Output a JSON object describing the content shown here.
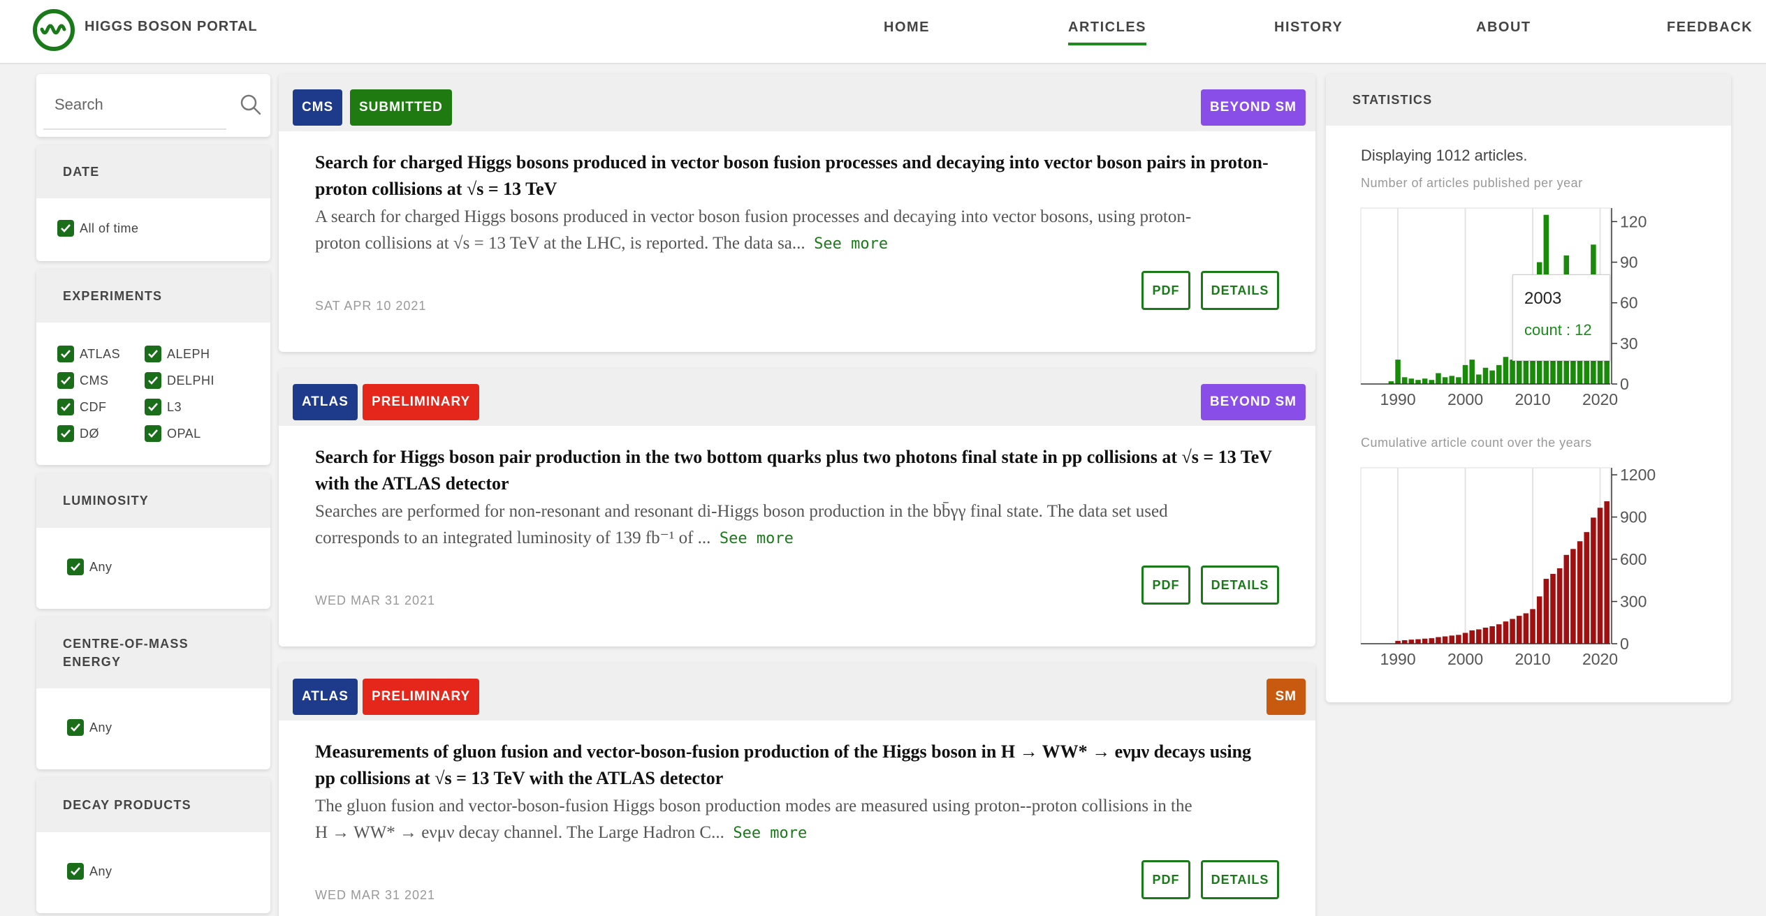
{
  "brand": "HIGGS BOSON PORTAL",
  "nav": [
    "HOME",
    "ARTICLES",
    "HISTORY",
    "ABOUT",
    "FEEDBACK"
  ],
  "search_placeholder": "Search",
  "filters": {
    "date": {
      "title": "DATE",
      "option": "All of time"
    },
    "experiments": {
      "title": "EXPERIMENTS",
      "left": [
        "ATLAS",
        "CMS",
        "CDF",
        "DØ"
      ],
      "right": [
        "ALEPH",
        "DELPHI",
        "L3",
        "OPAL"
      ]
    },
    "luminosity": {
      "title": "LUMINOSITY",
      "option": "Any"
    },
    "energy": {
      "title_line1": "CENTRE-OF-MASS",
      "title_line2": "ENERGY",
      "option": "Any"
    },
    "decay": {
      "title": "DECAY PRODUCTS",
      "option": "Any"
    }
  },
  "articles": [
    {
      "experiment": "CMS",
      "status": "SUBMITTED",
      "category": "BEYOND SM",
      "title_line1": "Search for charged Higgs bosons produced in vector boson fusion processes and decaying into vector boson pairs in proton-",
      "title_line2": "proton collisions at √s = 13 TeV",
      "abstract_line1": "A search for charged Higgs bosons produced in vector boson fusion processes and decaying into vector bosons, using proton-",
      "abstract_line2": "proton collisions at √s = 13 TeV at the LHC, is reported. The data sa...",
      "see_more": "See more",
      "date": "SAT APR 10 2021",
      "pdf": "PDF",
      "details": "DETAILS"
    },
    {
      "experiment": "ATLAS",
      "status": "PRELIMINARY",
      "category": "BEYOND SM",
      "title_line1": "Search for Higgs boson pair production in the two bottom quarks plus two photons final state in pp collisions at √s = 13 TeV",
      "title_line2": "with the ATLAS detector",
      "abstract_line1": "Searches are performed for non-resonant and resonant di-Higgs boson production in the bb̄γγ final state. The data set used",
      "abstract_line2": "corresponds to an integrated luminosity of 139 fb⁻¹ of ...",
      "see_more": "See more",
      "date": "WED MAR 31 2021",
      "pdf": "PDF",
      "details": "DETAILS"
    },
    {
      "experiment": "ATLAS",
      "status": "PRELIMINARY",
      "category": "SM",
      "title_line1": "Measurements of gluon fusion and vector-boson-fusion production of the Higgs boson in H → WW* → eνμν decays using",
      "title_line2": "pp collisions at √s = 13 TeV with the ATLAS detector",
      "abstract_line1": "The gluon fusion and vector-boson-fusion Higgs boson production modes are measured using proton--proton collisions in the",
      "abstract_line2": "H → WW* → eνμν decay channel. The Large Hadron C...",
      "see_more": "See more",
      "date": "WED MAR 31 2021",
      "pdf": "PDF",
      "details": "DETAILS"
    }
  ],
  "statistics": {
    "title": "STATISTICS",
    "display_text": "Displaying 1012 articles.",
    "chart1_label": "Number of articles published per year",
    "chart2_label": "Cumulative article count over the years",
    "tooltip_year": "2003",
    "tooltip_count": "count : 12"
  },
  "chart_data": [
    {
      "type": "bar",
      "x": [
        1985,
        1986,
        1987,
        1988,
        1989,
        1990,
        1991,
        1992,
        1993,
        1994,
        1995,
        1996,
        1997,
        1998,
        1999,
        2000,
        2001,
        2002,
        2003,
        2004,
        2005,
        2006,
        2007,
        2008,
        2009,
        2010,
        2011,
        2012,
        2013,
        2014,
        2015,
        2016,
        2017,
        2018,
        2019,
        2020,
        2021
      ],
      "values": [
        0,
        0,
        0,
        0,
        2,
        18,
        5,
        4,
        3,
        4,
        3,
        8,
        5,
        6,
        5,
        14,
        18,
        7,
        12,
        10,
        14,
        20,
        18,
        22,
        18,
        30,
        90,
        125,
        35,
        40,
        95,
        42,
        55,
        65,
        103,
        70,
        25
      ],
      "xticks": [
        1990,
        2000,
        2010,
        2020
      ],
      "yticks": [
        0,
        30,
        60,
        90,
        120
      ],
      "ylim": [
        0,
        130
      ],
      "color": "#1a8a0a"
    },
    {
      "type": "bar",
      "x": [
        1985,
        1986,
        1987,
        1988,
        1989,
        1990,
        1991,
        1992,
        1993,
        1994,
        1995,
        1996,
        1997,
        1998,
        1999,
        2000,
        2001,
        2002,
        2003,
        2004,
        2005,
        2006,
        2007,
        2008,
        2009,
        2010,
        2011,
        2012,
        2013,
        2014,
        2015,
        2016,
        2017,
        2018,
        2019,
        2020,
        2021
      ],
      "values": [
        0,
        0,
        0,
        0,
        2,
        20,
        25,
        29,
        32,
        36,
        39,
        47,
        52,
        58,
        63,
        77,
        95,
        102,
        114,
        124,
        138,
        158,
        176,
        198,
        216,
        246,
        336,
        461,
        496,
        536,
        631,
        673,
        728,
        793,
        896,
        966,
        1012
      ],
      "xticks": [
        1990,
        2000,
        2010,
        2020
      ],
      "yticks": [
        0,
        300,
        600,
        900,
        1200
      ],
      "ylim": [
        0,
        1250
      ],
      "color": "#a01010"
    }
  ]
}
